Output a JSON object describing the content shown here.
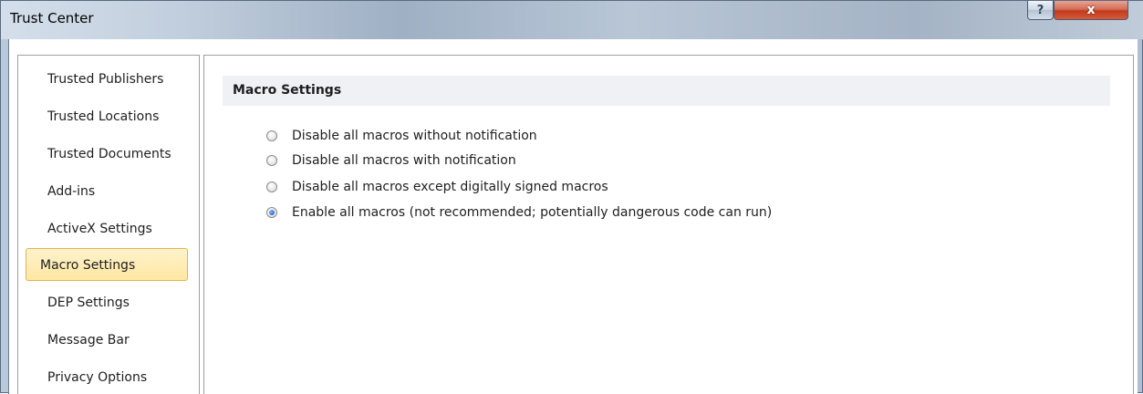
{
  "window": {
    "title": "Trust Center",
    "help_label": "?",
    "close_label": "x"
  },
  "sidebar": {
    "items": [
      {
        "label": "Trusted Publishers"
      },
      {
        "label": "Trusted Locations"
      },
      {
        "label": "Trusted Documents"
      },
      {
        "label": "Add-ins"
      },
      {
        "label": "ActiveX Settings"
      },
      {
        "label": "Macro Settings",
        "selected": true
      },
      {
        "label": "DEP Settings"
      },
      {
        "label": "Message Bar"
      },
      {
        "label": "Privacy Options"
      }
    ]
  },
  "main": {
    "section_title": "Macro Settings",
    "options": [
      {
        "label": "Disable all macros without notification",
        "checked": false
      },
      {
        "label": "Disable all macros with notification",
        "checked": false
      },
      {
        "label": "Disable all macros except digitally signed macros",
        "checked": false
      },
      {
        "label": "Enable all macros (not recommended; potentially dangerous code can run)",
        "checked": true
      }
    ]
  },
  "colors": {
    "selected_bg": "#ffe7a3",
    "selected_border": "#e5b34c",
    "close_button": "#c23b1c"
  }
}
